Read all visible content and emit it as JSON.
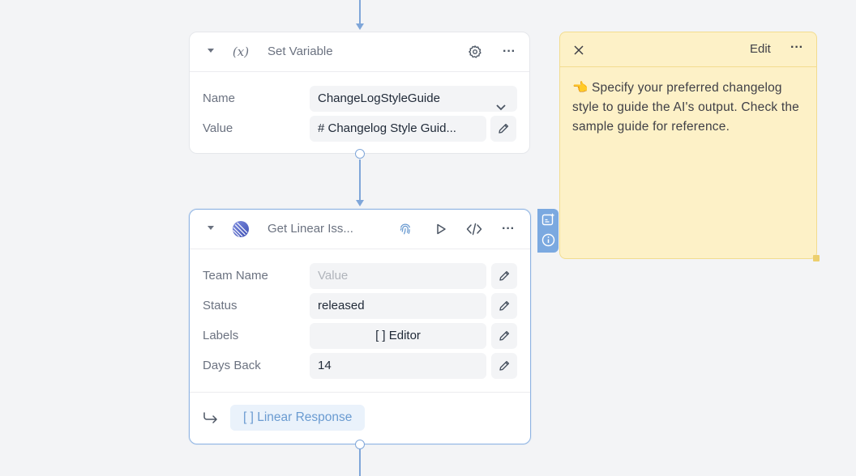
{
  "set_variable_node": {
    "title": "Set Variable",
    "icon": "variable-icon",
    "icon_text": "(x)",
    "fields": [
      {
        "label": "Name",
        "value": "ChangeLogStyleGuide"
      },
      {
        "label": "Value",
        "value": "# Changelog Style Guid..."
      }
    ]
  },
  "linear_node": {
    "title": "Get Linear Iss...",
    "icon": "linear-logo-icon",
    "fields": [
      {
        "label": "Team Name",
        "value": "",
        "placeholder": "Value"
      },
      {
        "label": "Status",
        "value": "released"
      },
      {
        "label": "Labels",
        "value": "[ ]  Editor"
      },
      {
        "label": "Days Back",
        "value": "14"
      }
    ],
    "output": {
      "label": "[ ]  Linear Response"
    }
  },
  "sticky_note": {
    "edit_label": "Edit",
    "emoji": "👈",
    "text": "Specify your preferred changelog style to guide the AI's output. Check the sample guide for reference."
  },
  "colors": {
    "accent": "#7fa6d9",
    "note_bg": "#fdf1c7",
    "canvas_bg": "#f3f4f6"
  }
}
